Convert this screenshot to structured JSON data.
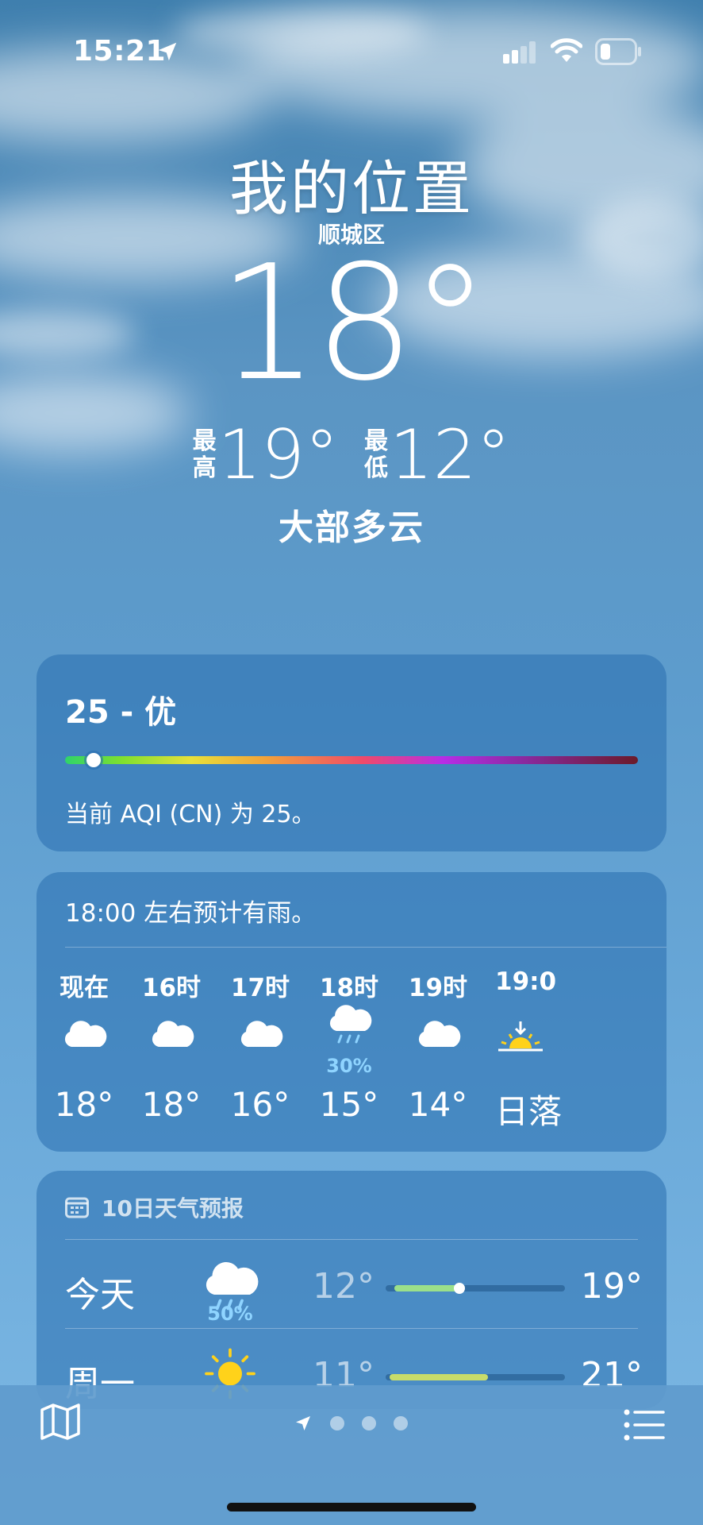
{
  "status_bar": {
    "time": "15:21"
  },
  "location": {
    "title": "我的位置",
    "district": "顺城区"
  },
  "current": {
    "temp": "18°",
    "high_label_1": "最",
    "high_label_2": "高",
    "high": "19°",
    "low_label_1": "最",
    "low_label_2": "低",
    "low": "12°",
    "condition": "大部多云"
  },
  "aqi": {
    "value_label": "25 - 优",
    "level_fraction": 0.05,
    "description": "当前 AQI (CN) 为 25。"
  },
  "hourly": {
    "headline": "18:00 左右预计有雨。",
    "items": [
      {
        "hour": "现在",
        "icon": "cloud-icon",
        "temp": "18°",
        "precip": ""
      },
      {
        "hour": "16时",
        "icon": "cloud-icon",
        "temp": "18°",
        "precip": ""
      },
      {
        "hour": "17时",
        "icon": "cloud-icon",
        "temp": "16°",
        "precip": ""
      },
      {
        "hour": "18时",
        "icon": "cloud-rain-icon",
        "temp": "15°",
        "precip": "30%"
      },
      {
        "hour": "19时",
        "icon": "cloud-icon",
        "temp": "14°",
        "precip": ""
      },
      {
        "hour": "19:0",
        "icon": "sunset-icon",
        "temp": "日落",
        "precip": ""
      }
    ]
  },
  "forecast": {
    "header": "10日天气预报",
    "days": [
      {
        "day": "今天",
        "icon": "cloud-rain-icon",
        "precip": "50%",
        "low": "12°",
        "high": "19°",
        "bar_start": 0.05,
        "bar_end": 0.41,
        "bar_color": "#9be08a",
        "current_fraction": 0.41
      },
      {
        "day": "周一",
        "icon": "sun-icon",
        "precip": "",
        "low": "11°",
        "high": "21°",
        "bar_start": 0.02,
        "bar_end": 0.57,
        "bar_color": "#c8dc6a"
      }
    ]
  },
  "colors": {
    "accent_precip": "#8fd4ff",
    "sun": "#ffd21a"
  },
  "page_dots": 3
}
